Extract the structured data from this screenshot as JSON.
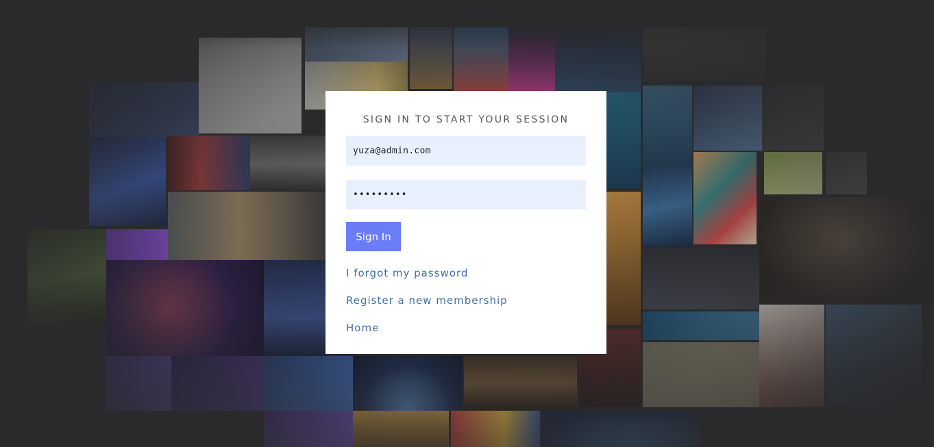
{
  "login": {
    "title": "SIGN IN TO START YOUR SESSION",
    "email_value": "yuza@admin.com",
    "password_value": "•••••••••",
    "submit_label": "Sign In",
    "links": {
      "forgot": "I forgot my password",
      "register": "Register a new membership",
      "home": "Home"
    }
  },
  "colors": {
    "page_background": "#2a2a2c",
    "card_background": "#ffffff",
    "input_background": "#e8f0fe",
    "button_accent": "#6b7cf7",
    "link_color": "#3e6fa6"
  }
}
